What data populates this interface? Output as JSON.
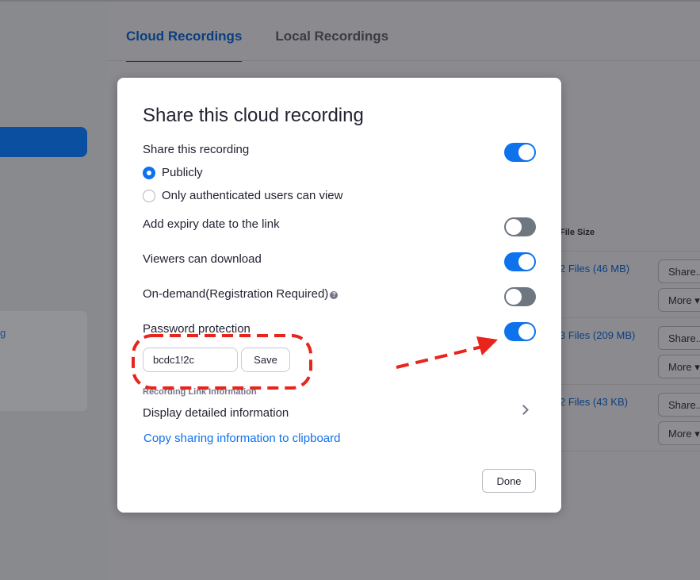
{
  "background": {
    "tabs": [
      {
        "label": "Cloud Recordings",
        "active": true
      },
      {
        "label": "Local Recordings",
        "active": false
      }
    ],
    "left_card_text": "g",
    "column_header": "File Size",
    "rows": [
      {
        "files": "2 Files (46 MB)",
        "share": "Share...",
        "more": "More ▾"
      },
      {
        "files": "3 Files (209 MB)",
        "share": "Share...",
        "more": "More ▾"
      },
      {
        "files": "2 Files (43 KB)",
        "share": "Share...",
        "more": "More ▾"
      }
    ]
  },
  "modal": {
    "title": "Share this cloud recording",
    "share_recording": {
      "label": "Share this recording",
      "enabled": true
    },
    "visibility_options": [
      {
        "label": "Publicly",
        "selected": true
      },
      {
        "label": "Only authenticated users can view",
        "selected": false
      }
    ],
    "expiry": {
      "label": "Add expiry date to the link",
      "enabled": false
    },
    "download": {
      "label": "Viewers can download",
      "enabled": true
    },
    "on_demand": {
      "label": "On-demand(Registration Required)",
      "enabled": false
    },
    "password": {
      "label": "Password protection",
      "enabled": true,
      "value": "bcdc1!2c",
      "save_label": "Save"
    },
    "section_label": "Recording Link Information",
    "details_label": "Display detailed information",
    "copy_link": "Copy sharing information to clipboard",
    "done_label": "Done"
  },
  "colors": {
    "accent": "#0e72ed",
    "toggle_off": "#6e7680",
    "annotation": "#e8241c"
  }
}
